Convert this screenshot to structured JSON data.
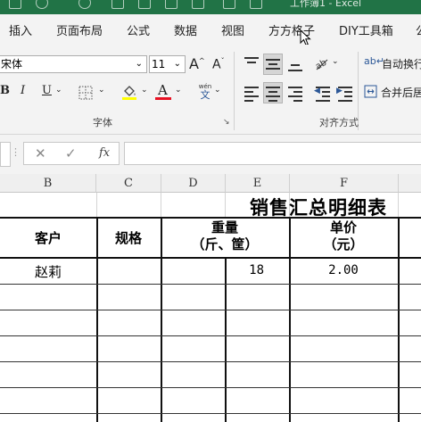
{
  "window": {
    "title": "工作簿1 - Excel"
  },
  "tabs": [
    "插入",
    "页面布局",
    "公式",
    "数据",
    "视图",
    "方方格子",
    "DIY工具箱",
    "公"
  ],
  "font": {
    "name": "宋体",
    "size": "11",
    "grow_label": "A",
    "shrink_label": "A"
  },
  "format": {
    "bold": "B",
    "italic": "I",
    "underline": "U",
    "font_color_label": "A",
    "phonetic_top": "wén",
    "phonetic_bottom": "文"
  },
  "alignment": {
    "wrap_text": "自动换行",
    "merge_center": "合并后居"
  },
  "groups": {
    "font": "字体",
    "alignment": "对齐方式"
  },
  "formula_bar": {
    "cancel": "✕",
    "confirm": "✓",
    "fx": "fx",
    "value": ""
  },
  "columns": [
    "B",
    "C",
    "D",
    "E",
    "F"
  ],
  "sheet": {
    "title": "销售汇总明细表",
    "headers": {
      "customer": "客户",
      "spec": "规格",
      "weight_line1": "重量",
      "weight_line2": "（斤、筐）",
      "price_line1": "单价",
      "price_line2": "（元）"
    },
    "rows": [
      {
        "customer": "赵莉",
        "weight": "18",
        "price": "2.00"
      }
    ]
  },
  "colors": {
    "title_bar": "#217346",
    "font_color": "#e81123",
    "highlight": "#ffff00"
  }
}
